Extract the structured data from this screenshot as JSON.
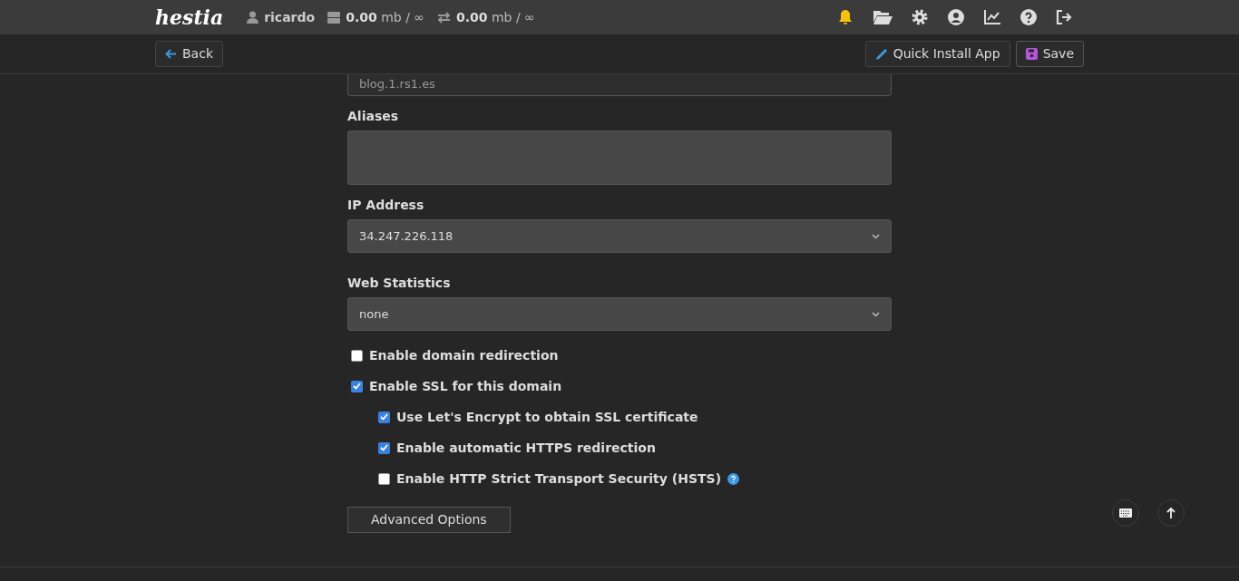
{
  "top_bar": {
    "logo": "hestia",
    "notifications": true,
    "user": "ricardo",
    "disk": {
      "value": "0.00",
      "unit": "mb / ∞"
    },
    "bandwidth": {
      "value": "0.00",
      "unit": "mb / ∞"
    }
  },
  "toolbar": {
    "back": "Back",
    "quick_install": "Quick Install App",
    "save": "Save"
  },
  "form": {
    "domain_field": {
      "value": "blog.1.rs1.es"
    },
    "aliases": {
      "label": "Aliases"
    },
    "ip_address": {
      "label": "IP Address",
      "value": "34.247.226.118"
    },
    "web_statistics": {
      "label": "Web Statistics",
      "value": "none"
    },
    "options": [
      {
        "label": "Enable domain redirection",
        "checked": false,
        "help": false
      },
      {
        "label": "Enable SSL for this domain",
        "checked": true,
        "help": false,
        "children": [
          {
            "label": "Use Let's Encrypt to obtain SSL certificate",
            "checked": true,
            "help": false
          },
          {
            "label": "Enable automatic HTTPS redirection",
            "checked": true,
            "help": false
          },
          {
            "label": "Enable HTTP Strict Transport Security (HSTS)",
            "checked": false,
            "help": true
          }
        ]
      }
    ],
    "advanced_button": "Advanced Options"
  }
}
